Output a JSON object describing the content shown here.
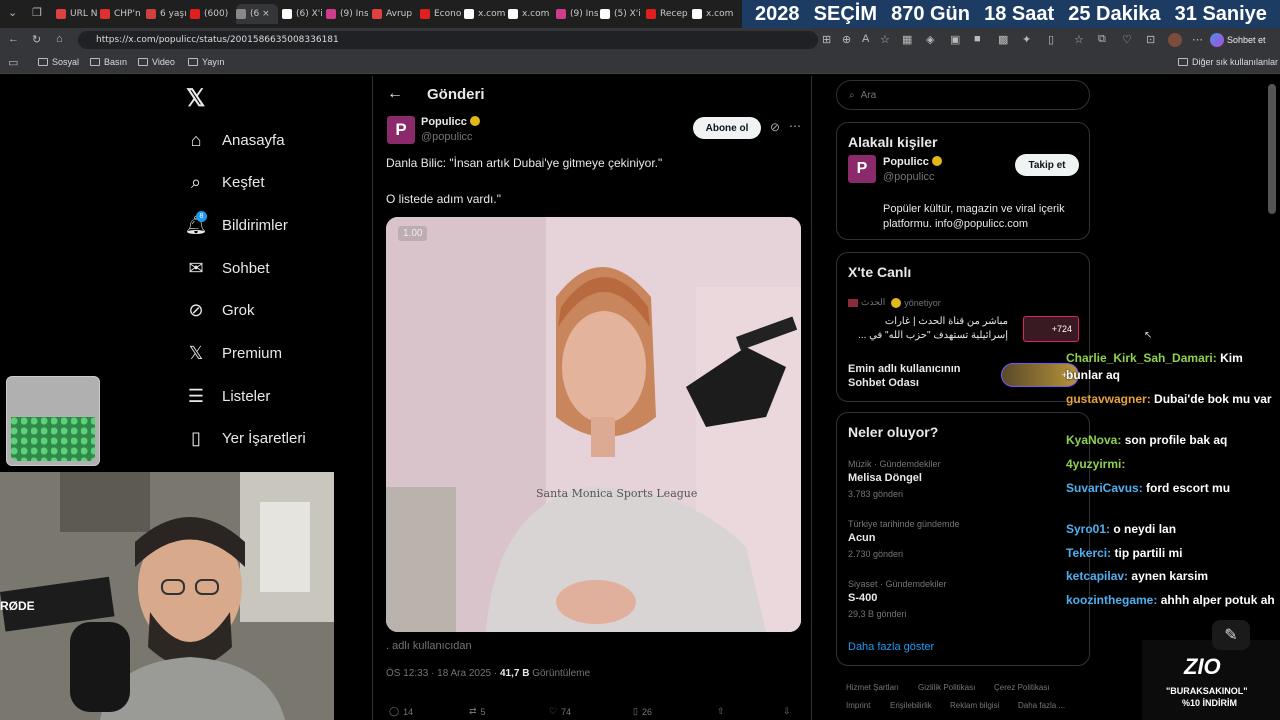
{
  "browser": {
    "tabs": [
      {
        "label": "URL N",
        "color": "#e04040"
      },
      {
        "label": "CHP'n",
        "color": "#e03030"
      },
      {
        "label": "6 yaşı",
        "color": "#d04040"
      },
      {
        "label": "(600)",
        "color": "#e02020"
      },
      {
        "label": "(6 ×",
        "color": "#888888"
      },
      {
        "label": "(6) X'i",
        "color": "#ffffff"
      },
      {
        "label": "(9) Ins",
        "color": "#d03c8c"
      },
      {
        "label": "Avrup",
        "color": "#e04040"
      },
      {
        "label": "Econo",
        "color": "#e02020"
      },
      {
        "label": "x.com",
        "color": "#ffffff"
      },
      {
        "label": "x.com",
        "color": "#ffffff"
      },
      {
        "label": "(9) Ins",
        "color": "#d03c8c"
      },
      {
        "label": "(5) X'i",
        "color": "#ffffff"
      },
      {
        "label": "Recep",
        "color": "#e02020"
      },
      {
        "label": "x.com",
        "color": "#ffffff"
      }
    ],
    "url": "https://x.com/populicc/status/2001586635008336181",
    "sohbet_label": "Sohbet et",
    "bookmarks": [
      "Sosyal",
      "Basın",
      "Video",
      "Yayın"
    ],
    "other_bookmarks": "Diğer sık kullanılanlar"
  },
  "countdown": {
    "year": "2028",
    "label": "SEÇİM",
    "days": "870 Gün",
    "hours": "18 Saat",
    "minutes": "25 Dakika",
    "seconds": "31 Saniye"
  },
  "nav": {
    "items": [
      {
        "label": "Anasayfa",
        "icon": "home-icon"
      },
      {
        "label": "Keşfet",
        "icon": "search-icon"
      },
      {
        "label": "Bildirimler",
        "icon": "bell-icon"
      },
      {
        "label": "Sohbet",
        "icon": "mail-icon"
      },
      {
        "label": "Grok",
        "icon": "grok-icon"
      },
      {
        "label": "Premium",
        "icon": "x-icon"
      },
      {
        "label": "Listeler",
        "icon": "list-icon"
      },
      {
        "label": "Yer İşaretleri",
        "icon": "bookmark-icon"
      }
    ],
    "notif_badge": "8"
  },
  "post": {
    "header_title": "Gönderi",
    "author_name": "Populicc",
    "author_handle": "@populicc",
    "avatar_letter": "P",
    "subscribe_label": "Abone ol",
    "text_line1": "Danla Bilic: \"İnsan artık Dubai'ye gitmeye çekiniyor.\"",
    "text_line2": "O listede adım vardı.\"",
    "speed_badge": "1.00",
    "via": ". adlı kullanıcıdan",
    "time": "ÖS 12:33 · 18 Ara 2025 ·",
    "views": "41,7 B",
    "views_label": "Görüntüleme",
    "actions": {
      "replies": "14",
      "reposts": "5",
      "likes": "74",
      "bookmarks": "26"
    }
  },
  "right": {
    "search_placeholder": "Ara",
    "related": {
      "title": "Alakalı kişiler",
      "name": "Populicc",
      "handle": "@populicc",
      "bio": "Popüler kültür, magazin ve viral içerik platformu. info@populicc.com",
      "follow_label": "Takip et"
    },
    "live": {
      "title": "X'te Canlı",
      "host": "الحدث",
      "host_suffix": "yönetiyor",
      "line1": "مباشر من قناة الحدث | غارات",
      "line2": "إسرائيلية تستهدف \"حزب الله\" في ...",
      "count1": "+724",
      "room_line1": "Emin adlı kullanıcının",
      "room_line2": "Sohbet Odası",
      "count2": "+4"
    },
    "trends": {
      "title": "Neler oluyor?",
      "items": [
        {
          "category": "Müzik · Gündemdekiler",
          "name": "Melisa Döngel",
          "count": "3.783 gönderi"
        },
        {
          "category": "Türkiye tarihinde gündemde",
          "name": "Acun",
          "count": "2.730 gönderi"
        },
        {
          "category": "Siyaset · Gündemdekiler",
          "name": "S-400",
          "count": "29,3 B gönderi"
        }
      ],
      "more_label": "Daha fazla göster"
    },
    "footer": [
      "Hizmet Şartları",
      "Gizlilik Politikası",
      "Çerez Politikası",
      "Imprint",
      "Erişilebilirlik",
      "Reklam bilgisi",
      "Daha fazla ..."
    ]
  },
  "chat": [
    {
      "user": "Charlie_Kirk_Sah_Damari",
      "msg": "Kim bunlar aq",
      "color": "#8fd14f"
    },
    {
      "user": "gustavwagner",
      "msg": "Dubai'de bok mu var",
      "color": "#e8a33c"
    },
    {
      "user": "KyaNova",
      "msg": "son profile bak aq",
      "color": "#8fd14f"
    },
    {
      "user": "4yuzyirmi",
      "msg": "",
      "color": "#8fd14f"
    },
    {
      "user": "SuvariCavus",
      "msg": "ford escort mu",
      "color": "#4fb0f0"
    },
    {
      "user": "Syro01",
      "msg": "o neydi lan",
      "color": "#4fb0f0"
    },
    {
      "user": "Tekerci",
      "msg": "tip partili mi",
      "color": "#4fb0f0"
    },
    {
      "user": "ketcapilav",
      "msg": "aynen karsim",
      "color": "#4fb0f0"
    },
    {
      "user": "koozinthegame",
      "msg": "ahhh alper potuk ah",
      "color": "#4fb0f0"
    }
  ],
  "overlay": {
    "brand": "ZIO",
    "promo1": "\"BURAKSAKINOL\"",
    "promo2": "%10 İNDİRİM",
    "mic_brand": "RØDE"
  }
}
